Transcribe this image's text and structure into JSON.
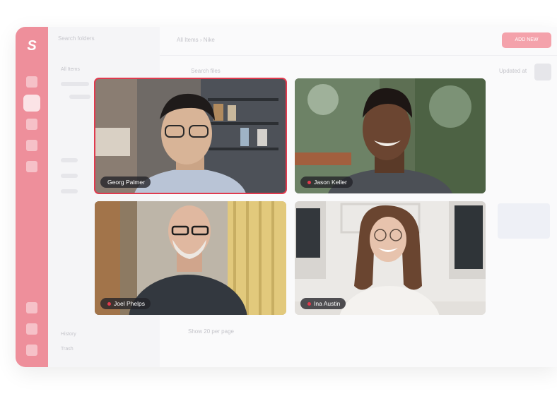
{
  "app": {
    "logo_letter": "S",
    "accent_color": "#ee8f9b",
    "active_speaker_color": "#e03a4e"
  },
  "background_ui": {
    "search_placeholder": "Search folders",
    "breadcrumb_root": "All Items",
    "breadcrumb_current": "Nike",
    "add_button": "ADD NEW",
    "folder_root": "All Items",
    "content_search_placeholder": "Search files",
    "sort_label": "Updated at",
    "bottom_links": [
      "History",
      "Trash"
    ],
    "pagination": {
      "show_label": "Show",
      "per_page_value": "20",
      "per_page_label": "per page"
    }
  },
  "participants": [
    {
      "name": "Georg Palmer",
      "muted": false,
      "active_speaker": true
    },
    {
      "name": "Jason Keller",
      "muted": true,
      "active_speaker": false
    },
    {
      "name": "Joel Phelps",
      "muted": true,
      "active_speaker": false
    },
    {
      "name": "Ina Austin",
      "muted": true,
      "active_speaker": false
    }
  ]
}
